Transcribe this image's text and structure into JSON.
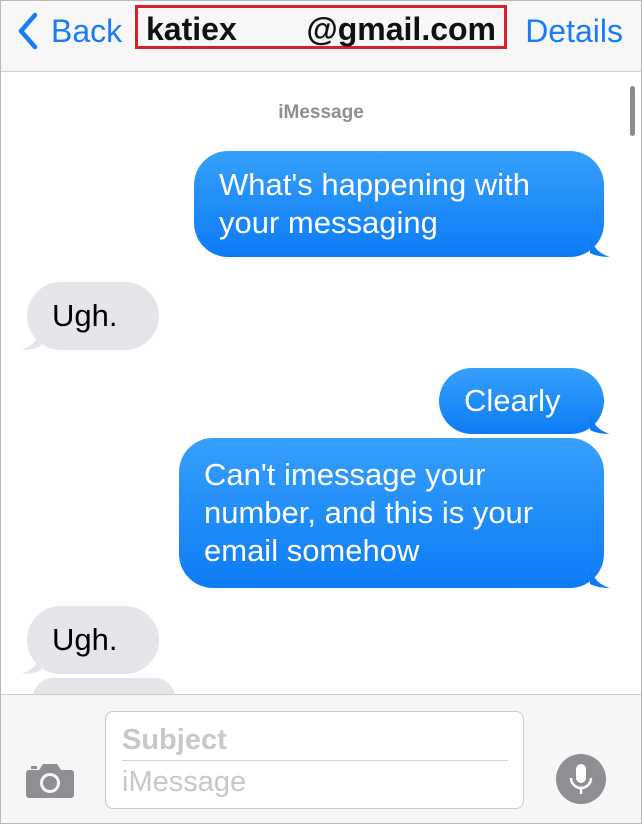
{
  "nav": {
    "back_label": "Back",
    "contact_user": "katiex",
    "contact_domain": "@gmail.com",
    "details_label": "Details"
  },
  "conversation": {
    "service_label": "iMessage",
    "messages": [
      {
        "direction": "outgoing",
        "lines": [
          "What's happening with",
          "your messaging"
        ]
      },
      {
        "direction": "incoming",
        "lines": [
          "Ugh."
        ]
      },
      {
        "direction": "outgoing",
        "lines": [
          "Clearly"
        ]
      },
      {
        "direction": "outgoing",
        "lines": [
          "Can't imessage your",
          "number, and this is your",
          "email somehow"
        ]
      },
      {
        "direction": "incoming",
        "lines": [
          "Ugh."
        ]
      },
      {
        "direction": "incoming",
        "lines": []
      }
    ]
  },
  "input": {
    "subject_placeholder": "Subject",
    "message_placeholder": "iMessage"
  },
  "icons": {
    "back": "chevron-left-icon",
    "camera": "camera-icon",
    "mic": "microphone-icon"
  },
  "colors": {
    "accent": "#1a7cf5",
    "outgoing_top": "#36a0fb",
    "outgoing_bottom": "#0d7bf6",
    "incoming": "#e5e5ea",
    "highlight_box": "#d8202c"
  }
}
